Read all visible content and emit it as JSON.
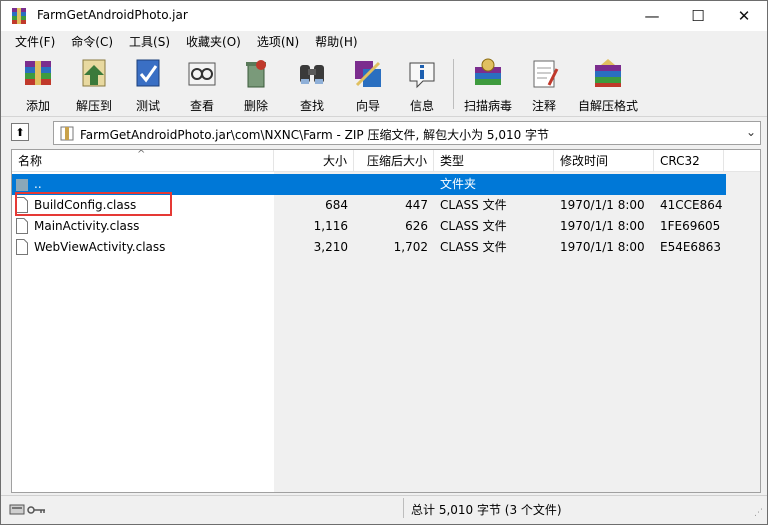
{
  "window": {
    "title": "FarmGetAndroidPhoto.jar",
    "minimize_glyph": "—",
    "maximize_glyph": "☐",
    "close_glyph": "✕"
  },
  "menu": [
    "文件(F)",
    "命令(C)",
    "工具(S)",
    "收藏夹(O)",
    "选项(N)",
    "帮助(H)"
  ],
  "toolbar": [
    {
      "label": "添加",
      "icon": "add-archive-icon"
    },
    {
      "label": "解压到",
      "icon": "extract-to-icon"
    },
    {
      "label": "测试",
      "icon": "test-icon"
    },
    {
      "label": "查看",
      "icon": "view-icon"
    },
    {
      "label": "删除",
      "icon": "delete-icon"
    },
    {
      "label": "查找",
      "icon": "find-icon"
    },
    {
      "label": "向导",
      "icon": "wizard-icon"
    },
    {
      "label": "信息",
      "icon": "info-icon"
    },
    {
      "label": "扫描病毒",
      "icon": "virus-scan-icon"
    },
    {
      "label": "注释",
      "icon": "comment-icon"
    },
    {
      "label": "自解压格式",
      "icon": "sfx-icon"
    }
  ],
  "address": {
    "path": "FarmGetAndroidPhoto.jar\\com\\NXNC\\Farm - ZIP 压缩文件, 解包大小为 5,010 字节",
    "up_glyph": "⬆",
    "dropdown_glyph": "⌄"
  },
  "columns": {
    "name": "名称",
    "size": "大小",
    "packed": "压缩后大小",
    "type": "类型",
    "modified": "修改时间",
    "crc": "CRC32",
    "sort_glyph": "^"
  },
  "rows": [
    {
      "name": "..",
      "size": "",
      "packed": "",
      "type": "文件夹",
      "modified": "",
      "crc": ""
    },
    {
      "name": "BuildConfig.class",
      "size": "684",
      "packed": "447",
      "type": "CLASS 文件",
      "modified": "1970/1/1 8:00",
      "crc": "41CCE864"
    },
    {
      "name": "MainActivity.class",
      "size": "1,116",
      "packed": "626",
      "type": "CLASS 文件",
      "modified": "1970/1/1 8:00",
      "crc": "1FE69605"
    },
    {
      "name": "WebViewActivity.class",
      "size": "3,210",
      "packed": "1,702",
      "type": "CLASS 文件",
      "modified": "1970/1/1 8:00",
      "crc": "E54E6863"
    }
  ],
  "status": {
    "summary": "总计 5,010 字节 (3 个文件)"
  },
  "colors": {
    "selection": "#0078d7",
    "highlight_box": "#e53935"
  }
}
